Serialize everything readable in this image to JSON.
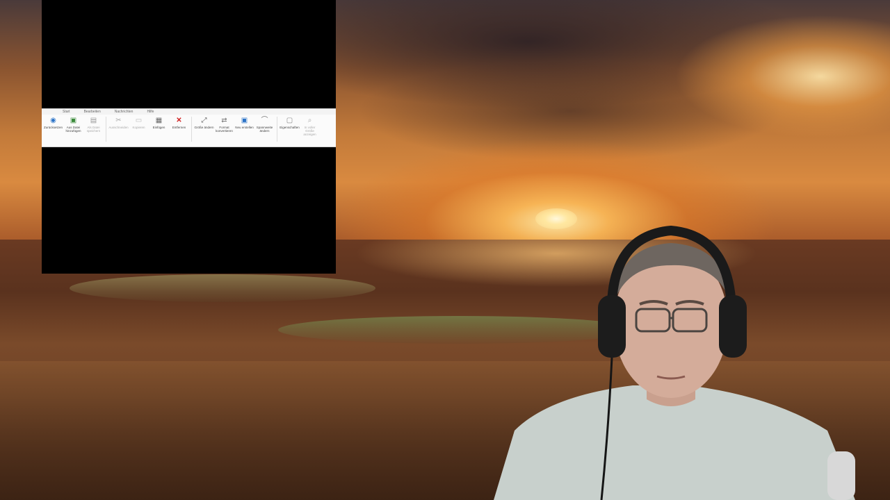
{
  "scene": {
    "background": "sunset-sea",
    "colors": {
      "sky_glow": "#ffd98a",
      "sea": "#5a321e",
      "capture_bg": "#000000",
      "ribbon_bg": "#fbfbfb",
      "ribbon_active_tab": "#2b73c7"
    }
  },
  "ribbon": {
    "tabs": [
      {
        "label": "",
        "active": true
      },
      {
        "label": "Start"
      },
      {
        "label": "Bearbeiten"
      },
      {
        "label": "Nachrichten"
      },
      {
        "label": "Hilfe"
      }
    ],
    "buttons": [
      {
        "label": "Zurücksetzen",
        "icon": "globe-icon",
        "disabled": false
      },
      {
        "label": "Aus Datei hinzufügen",
        "icon": "add-file-icon",
        "disabled": false
      },
      {
        "label": "Als Datei speichern",
        "icon": "save-file-icon",
        "disabled": true
      },
      {
        "label": "Ausschneiden",
        "icon": "cut-icon",
        "disabled": true
      },
      {
        "label": "Kopieren",
        "icon": "copy-icon",
        "disabled": true
      },
      {
        "label": "Einfügen",
        "icon": "paste-icon",
        "disabled": false
      },
      {
        "label": "Entfernen",
        "icon": "delete-x-icon",
        "disabled": false
      },
      {
        "label": "Größe ändern",
        "icon": "resize-icon",
        "disabled": false
      },
      {
        "label": "Format konvertieren",
        "icon": "convert-icon",
        "disabled": false
      },
      {
        "label": "Neu erstellen",
        "icon": "new-icon",
        "disabled": false
      },
      {
        "label": "Spannweite ändern",
        "icon": "span-icon",
        "disabled": false
      },
      {
        "label": "Eigenschaften",
        "icon": "properties-icon",
        "disabled": false
      },
      {
        "label": "In voller Größe anzeigen",
        "icon": "zoom-icon",
        "disabled": true
      }
    ]
  }
}
